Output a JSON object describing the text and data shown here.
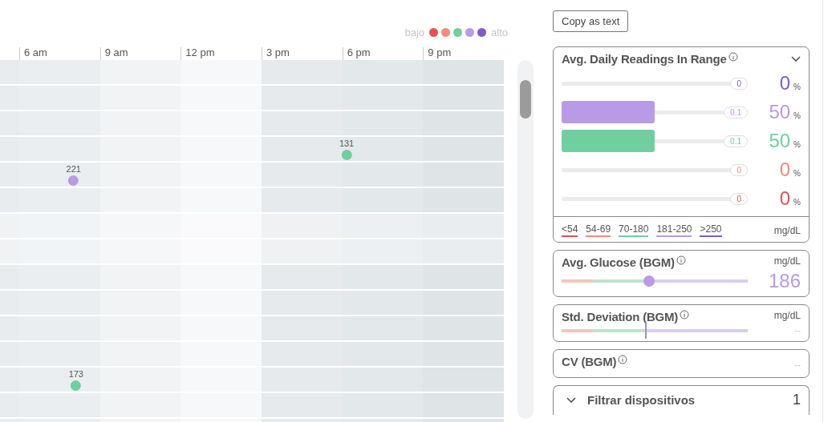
{
  "legend": {
    "low_label": "bajo",
    "high_label": "alto",
    "levels": [
      {
        "color": "#e8504f"
      },
      {
        "color": "#f28b7a"
      },
      {
        "color": "#6fcf9f"
      },
      {
        "color": "#b99ae6"
      },
      {
        "color": "#7e5bc8"
      }
    ]
  },
  "chart": {
    "ticks": [
      "6 am",
      "9 am",
      "12 pm",
      "3 pm",
      "6 pm",
      "9 pm"
    ],
    "rows": [
      {
        "readings": []
      },
      {
        "readings": []
      },
      {
        "readings": []
      },
      {
        "readings": [
          {
            "value": "131",
            "color": "#6fcf9f"
          }
        ]
      },
      {
        "readings": [
          {
            "value": "221",
            "color": "#b99ae6"
          }
        ]
      },
      {
        "readings": []
      },
      {
        "readings": []
      },
      {
        "readings": []
      },
      {
        "readings": []
      },
      {
        "readings": []
      },
      {
        "readings": []
      },
      {
        "readings": []
      },
      {
        "readings": [
          {
            "value": "173",
            "color": "#6fcf9f"
          }
        ]
      },
      {
        "readings": []
      }
    ]
  },
  "copy_button": "Copy as text",
  "readings_in_range": {
    "title": "Avg. Daily Readings In Range",
    "expanded": true,
    "bars": [
      {
        "pill": "0",
        "percent": "0",
        "unit": "%",
        "color": "#7e5bc8"
      },
      {
        "pill": "0.1",
        "percent": "50",
        "unit": "%",
        "color": "#b99ae6",
        "level": 0.5
      },
      {
        "pill": "0.1",
        "percent": "50",
        "unit": "%",
        "color": "#6fcf9f",
        "level": 0.5
      },
      {
        "pill": "0",
        "percent": "0",
        "unit": "%",
        "color": "#f28b7a"
      },
      {
        "pill": "0",
        "percent": "0",
        "unit": "%",
        "color": "#e05252"
      }
    ],
    "ranges": [
      {
        "label": "<54",
        "color": "#e05252"
      },
      {
        "label": "54-69",
        "color": "#f28b7a"
      },
      {
        "label": "70-180",
        "color": "#6fcf9f"
      },
      {
        "label": "181-250",
        "color": "#b99ae6"
      },
      {
        "label": ">250",
        "color": "#7e5bc8"
      }
    ],
    "unit": "mg/dL"
  },
  "stats": [
    {
      "kind": "dot",
      "title": "Avg. Glucose (BGM)",
      "unit": "mg/dL",
      "value": "186",
      "level": 0.47,
      "color": "#b99ae6"
    },
    {
      "kind": "line",
      "title": "Std. Deviation (BGM)",
      "unit": "mg/dL",
      "value": "--",
      "level": 0.45,
      "color": "#c8c8cc"
    },
    {
      "kind": "plain",
      "title": "CV (BGM)",
      "value": "--",
      "color": "#c8c8cc"
    }
  ],
  "device_filter": {
    "label": "Filtrar dispositivos",
    "count": "1",
    "expanded": false
  }
}
